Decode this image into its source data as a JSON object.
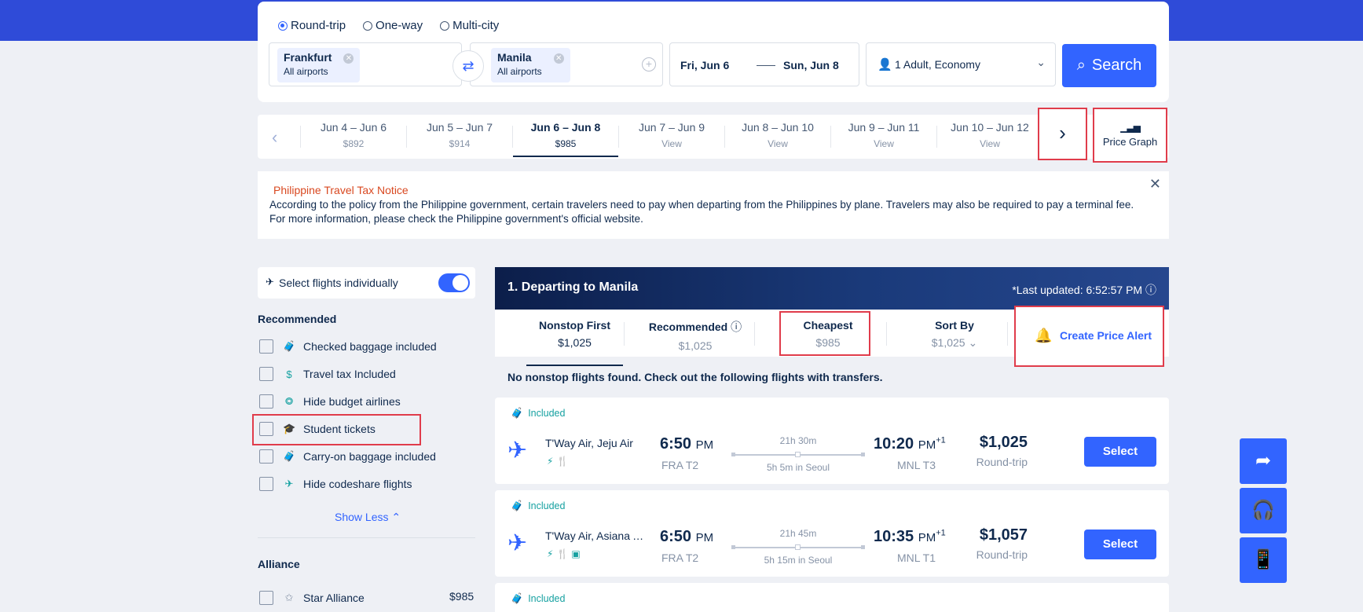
{
  "search": {
    "trip_types": [
      "Round-trip",
      "One-way",
      "Multi-city"
    ],
    "selected_trip_type": "Round-trip",
    "origin": {
      "name": "Frankfurt",
      "sub": "All airports"
    },
    "destination": {
      "name": "Manila",
      "sub": "All airports"
    },
    "depart_date": "Fri, Jun 6",
    "return_date": "Sun, Jun 8",
    "passengers": "1 Adult, Economy",
    "search_label": "Search"
  },
  "date_strip": {
    "items": [
      {
        "range": "Jun 4 – Jun 6",
        "price": "$892"
      },
      {
        "range": "Jun 5 – Jun 7",
        "price": "$914"
      },
      {
        "range": "Jun 6 – Jun 8",
        "price": "$985"
      },
      {
        "range": "Jun 7 – Jun 9",
        "price": "View"
      },
      {
        "range": "Jun 8 – Jun 10",
        "price": "View"
      },
      {
        "range": "Jun 9 – Jun 11",
        "price": "View"
      },
      {
        "range": "Jun 10 – Jun 12",
        "price": "View"
      }
    ],
    "active_index": 2,
    "price_graph_label": "Price Graph"
  },
  "notice": {
    "title": "Philippine Travel Tax Notice",
    "text": "According to the policy from the Philippine government, certain travelers need to pay when departing from the Philippines by plane. Travelers may also be required to pay a terminal fee. For more information, please check the Philippine government's official website."
  },
  "filters": {
    "individually_label": "Select flights individually",
    "individually_on": true,
    "recommended_title": "Recommended",
    "recommended_items": [
      {
        "label": "Checked baggage included",
        "icon": "baggage-icon"
      },
      {
        "label": "Travel tax Included",
        "icon": "tax-icon"
      },
      {
        "label": "Hide budget airlines",
        "icon": "tag-icon"
      },
      {
        "label": "Student tickets",
        "icon": "graduation-cap-icon"
      },
      {
        "label": "Carry-on baggage included",
        "icon": "carry-on-icon"
      },
      {
        "label": "Hide codeshare flights",
        "icon": "plane-icon"
      }
    ],
    "show_less_label": "Show Less",
    "alliance_title": "Alliance",
    "alliance_items": [
      {
        "label": "Star Alliance",
        "price": "$985"
      }
    ]
  },
  "results": {
    "title": "1. Departing to Manila",
    "last_updated": "*Last updated: 6:52:57 PM",
    "sort_tabs": [
      {
        "name": "Nonstop First",
        "value": "$1,025"
      },
      {
        "name": "Recommended",
        "value": "$1,025"
      },
      {
        "name": "Cheapest",
        "value": "$985"
      },
      {
        "name": "Sort By",
        "value": "$1,025"
      }
    ],
    "active_sort": 0,
    "price_alert_label": "Create Price Alert",
    "no_nonstop_msg": "No nonstop flights found. Check out the following flights with transfers.",
    "flights": [
      {
        "included": "Included",
        "airline": "T'Way Air, Jeju Air",
        "dep_time": "6:50",
        "dep_ampm": "PM",
        "dep_airport": "FRA T2",
        "duration": "21h 30m",
        "stop": "5h 5m in Seoul",
        "arr_time": "10:20",
        "arr_ampm": "PM",
        "arr_offset": "+1",
        "arr_airport": "MNL T3",
        "price": "$1,025",
        "price_type": "Round-trip",
        "select_label": "Select"
      },
      {
        "included": "Included",
        "airline": "T'Way Air, Asiana A...",
        "dep_time": "6:50",
        "dep_ampm": "PM",
        "dep_airport": "FRA T2",
        "duration": "21h 45m",
        "stop": "5h 15m in Seoul",
        "arr_time": "10:35",
        "arr_ampm": "PM",
        "arr_offset": "+1",
        "arr_airport": "MNL T1",
        "price": "$1,057",
        "price_type": "Round-trip",
        "select_label": "Select"
      },
      {
        "included": "Included"
      }
    ]
  },
  "colors": {
    "brand": "#3264ff",
    "header_band": "#2f4bd8",
    "highlight_box": "#e03c4b",
    "included_teal": "#16a1a1"
  }
}
